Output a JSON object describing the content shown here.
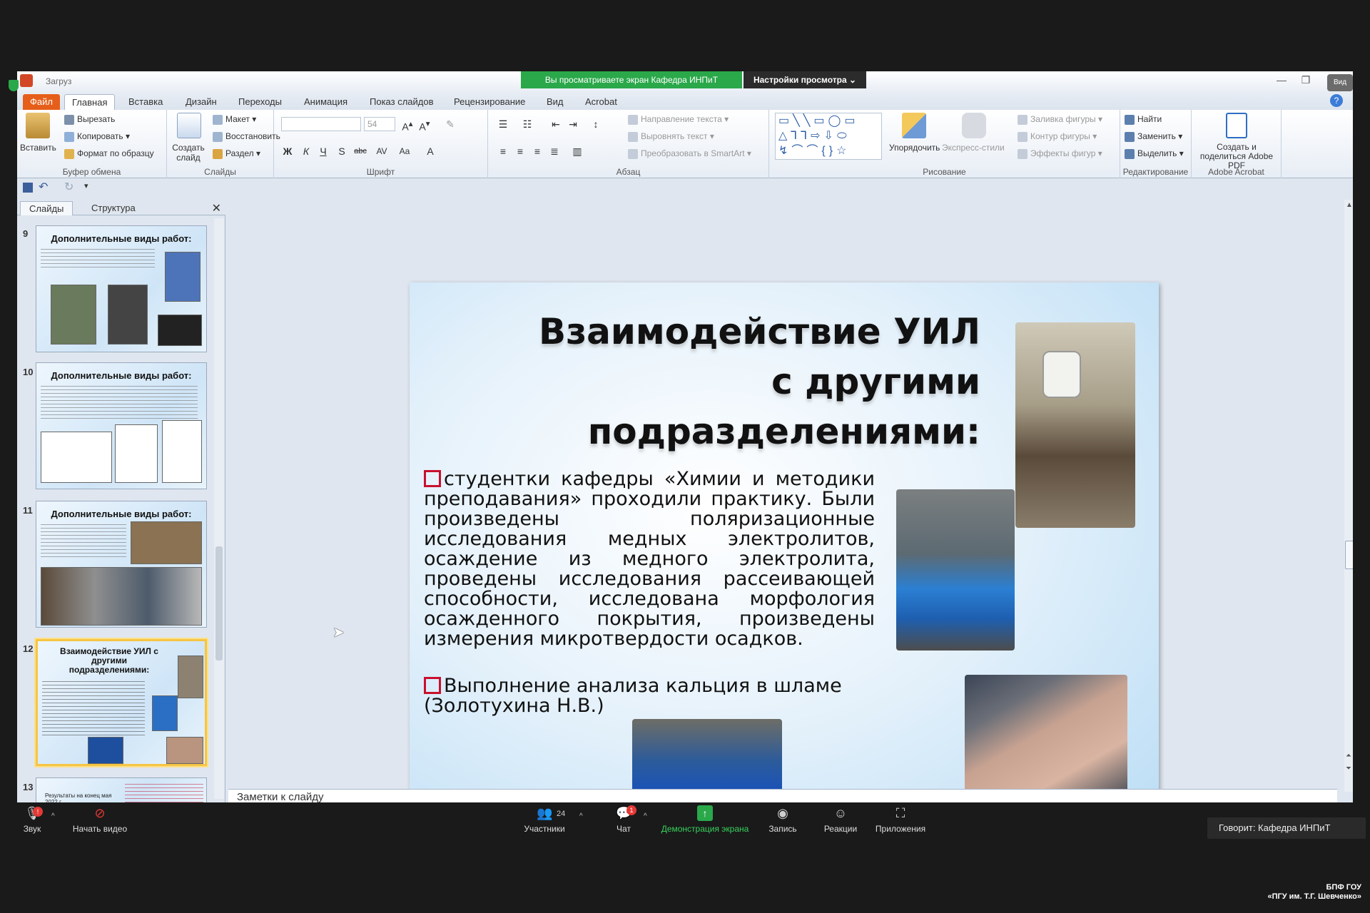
{
  "window": {
    "title": "Загруз",
    "share_banner": "Вы просматриваете экран Кафедра ИНПиТ",
    "view_settings": "Настройки просмотра ⌄",
    "side_video": "Вид"
  },
  "ribbon_tabs": [
    "Файл",
    "Главная",
    "Вставка",
    "Дизайн",
    "Переходы",
    "Анимация",
    "Показ слайдов",
    "Рецензирование",
    "Вид",
    "Acrobat"
  ],
  "clipboard": {
    "paste": "Вставить",
    "cut": "Вырезать",
    "copy": "Копировать",
    "format_painter": "Формат по образцу",
    "label": "Буфер обмена"
  },
  "slides_group": {
    "new_slide": "Создать слайд",
    "layout": "Макет",
    "reset": "Восстановить",
    "section": "Раздел",
    "label": "Слайды"
  },
  "font_group": {
    "font_size": "54",
    "label": "Шрифт",
    "bold": "Ж",
    "italic": "К",
    "underline": "Ч",
    "strike": "S",
    "abc": "abc"
  },
  "paragraph_group": {
    "text_direction": "Направление текста",
    "align_text": "Выровнять текст",
    "smartart": "Преобразовать в SmartArt",
    "label": "Абзац"
  },
  "drawing_group": {
    "arrange": "Упорядочить",
    "quick_styles": "Экспресс-стили",
    "shape_fill": "Заливка фигуры",
    "shape_outline": "Контур фигуры",
    "shape_effects": "Эффекты фигур",
    "label": "Рисование"
  },
  "editing_group": {
    "find": "Найти",
    "replace": "Заменить",
    "select": "Выделить",
    "label": "Редактирование"
  },
  "acrobat_group": {
    "create_share": "Создать и поделиться Adobe PDF",
    "label": "Adobe Acrobat"
  },
  "panel": {
    "tab_slides": "Слайды",
    "tab_outline": "Структура",
    "close": "✕"
  },
  "thumbnails": [
    {
      "num": "9",
      "title": "Дополнительные виды работ:"
    },
    {
      "num": "10",
      "title": "Дополнительные виды работ:"
    },
    {
      "num": "11",
      "title": "Дополнительные виды работ:"
    },
    {
      "num": "12",
      "title": "Взаимодействие УИЛ с другими подразделениями:"
    },
    {
      "num": "13",
      "title": "Результаты на конец мая 2022 г."
    }
  ],
  "slide": {
    "title": "Взаимодействие УИЛ с другими подразделениями:",
    "bullets": [
      "студентки кафедры «Химии и методики преподавания» проходили практику. Были произведены поляризационные исследования медных электролитов, осаждение из медного электролита, проведены исследования рассеивающей способности, исследована морфология осажденного покрытия, произведены измерения микротвердости осадков.",
      "Выполнение анализа кальция в шламе (Золотухина Н.В.)"
    ]
  },
  "notes_placeholder": "Заметки к слайду",
  "zoom_toolbar": {
    "audio": "Звук",
    "video": "Начать видео",
    "participants": "Участники",
    "participants_count": "24",
    "chat": "Чат",
    "chat_badge": "1",
    "share": "Демонстрация экрана",
    "record": "Запись",
    "reactions": "Реакции",
    "apps": "Приложения"
  },
  "speaker": "Говорит: Кафедра ИНПиТ",
  "watermark": {
    "line1": "БПФ ГОУ",
    "line2": "«ПГУ им. Т.Г. Шевченко»"
  },
  "colors": {
    "share_green": "#2aa84a",
    "file_tab": "#e65f1a",
    "bullet_red": "#c8102e",
    "selected_thumb": "#f6c544"
  }
}
